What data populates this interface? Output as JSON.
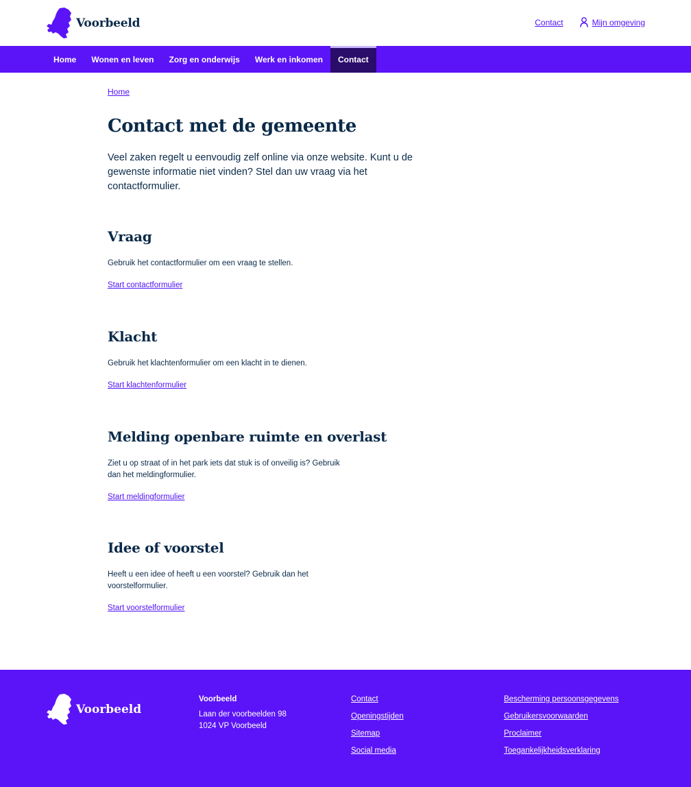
{
  "header": {
    "logo_text": "Voorbeeld",
    "top_links": {
      "contact": "Contact",
      "account": "Mijn omgeving"
    }
  },
  "nav": {
    "items": [
      "Home",
      "Wonen en leven",
      "Zorg en onderwijs",
      "Werk en inkomen",
      "Contact"
    ],
    "active": "Contact"
  },
  "main": {
    "breadcrumb": "Home",
    "title": "Contact met de gemeente",
    "intro": "Veel zaken regelt u eenvoudig zelf online via onze website. Kunt u de gewenste informatie niet vinden? Stel dan uw vraag via het contactformulier.",
    "sections": [
      {
        "title": "Vraag",
        "text": "Gebruik het contactformulier om een vraag te stellen.",
        "link": "Start contactformulier"
      },
      {
        "title": "Klacht",
        "text": "Gebruik het klachtenformulier om een klacht in te dienen.",
        "link": "Start klachtenformulier"
      },
      {
        "title": "Melding openbare ruimte en overlast",
        "text": "Ziet u op straat of in het park iets dat stuk is of onveilig is? Gebruik dan het meldingformulier.",
        "link": "Start meldingformulier"
      },
      {
        "title": "Idee of voorstel",
        "text": "Heeft u een idee of heeft u een voorstel? Gebruik dan het voorstelformulier.",
        "link": "Start voorstelformulier"
      }
    ]
  },
  "footer": {
    "logo_text": "Voorbeeld",
    "address": {
      "name": "Voorbeeld",
      "street": "Laan der voorbeelden 98",
      "city": "1024 VP Voorbeeld"
    },
    "links_col1": [
      "Contact",
      "Openingstijden",
      "Sitemap",
      "Social media"
    ],
    "links_col2": [
      "Bescherming persoonsgegevens",
      "Gebruikersvoorwaarden",
      "Proclaimer",
      "Toegankelijkheidsverklaring"
    ]
  },
  "colors": {
    "brand": "#5b14f7",
    "nav_active": "#2a0c6b",
    "text": "#0b2a49",
    "link": "#5314f5"
  },
  "icons": {
    "logo": "netherlands-map-icon",
    "account": "user-icon"
  }
}
